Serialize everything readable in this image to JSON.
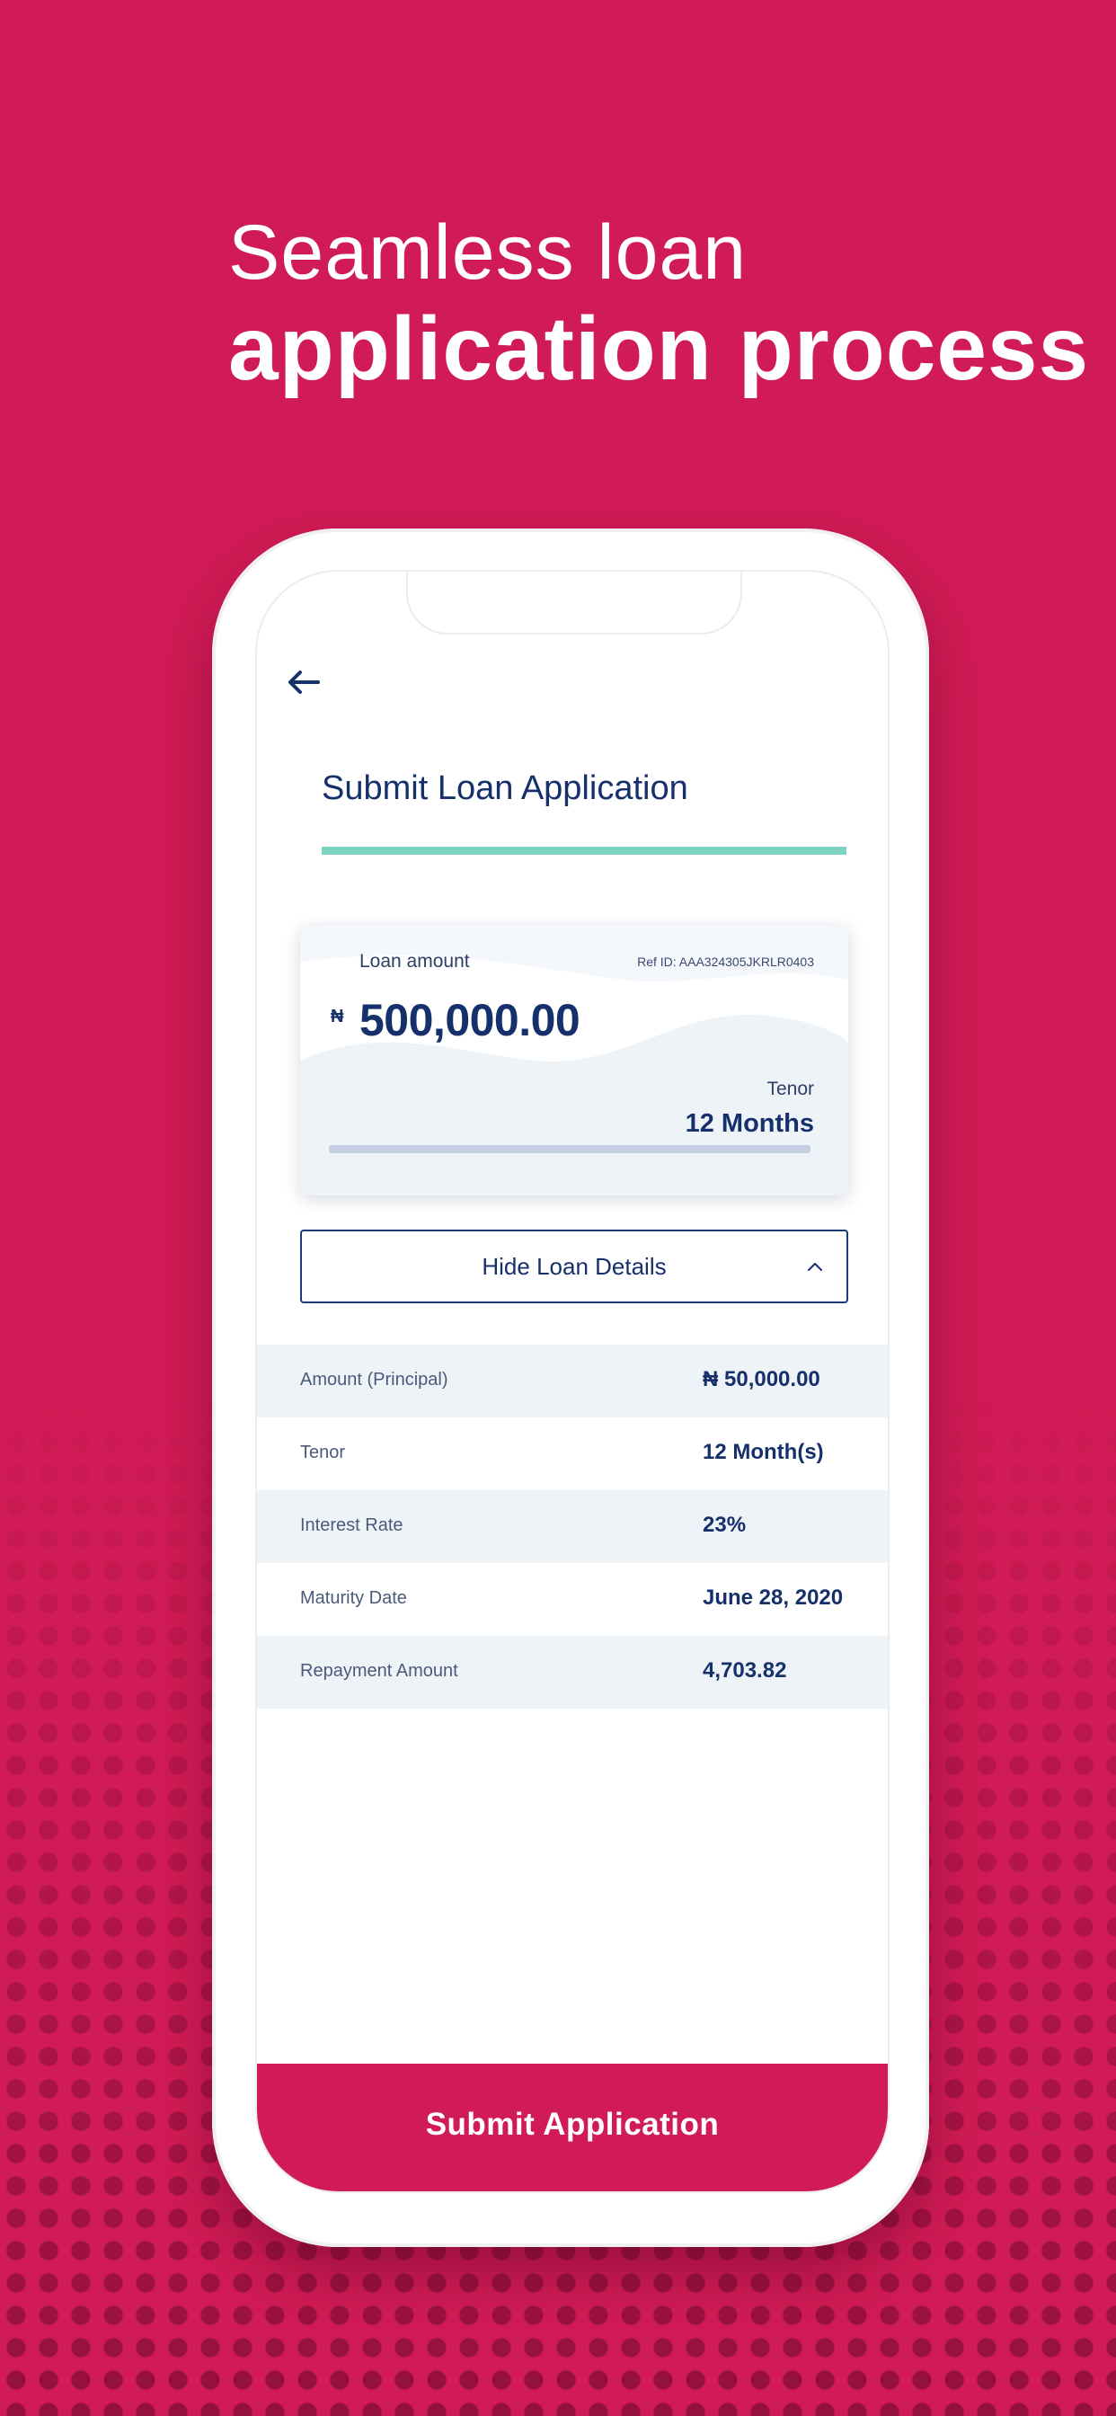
{
  "colors": {
    "background": "#d11b56",
    "brand_navy": "#16306b",
    "accent_teal": "#7fd3c2",
    "submit_button": "#d11b56"
  },
  "headline": {
    "line1": "Seamless loan",
    "line2": "application process"
  },
  "screen": {
    "back_icon": "arrow-left-icon",
    "title": "Submit Loan Application",
    "card": {
      "loan_label": "Loan amount",
      "ref_id": "Ref ID: AAA324305JKRLR0403",
      "currency_symbol": "₦",
      "amount": "500,000.00",
      "tenor_label": "Tenor",
      "tenor_value": "12 Months"
    },
    "toggle": {
      "label": "Hide Loan Details",
      "icon": "chevron-up-icon"
    },
    "details": [
      {
        "key": "Amount (Principal)",
        "value": "₦ 50,000.00"
      },
      {
        "key": "Tenor",
        "value": "12 Month(s)"
      },
      {
        "key": "Interest Rate",
        "value": "23%"
      },
      {
        "key": "Maturity Date",
        "value": "June 28, 2020"
      },
      {
        "key": "Repayment Amount",
        "value": "4,703.82"
      }
    ],
    "submit_label": "Submit Application"
  }
}
